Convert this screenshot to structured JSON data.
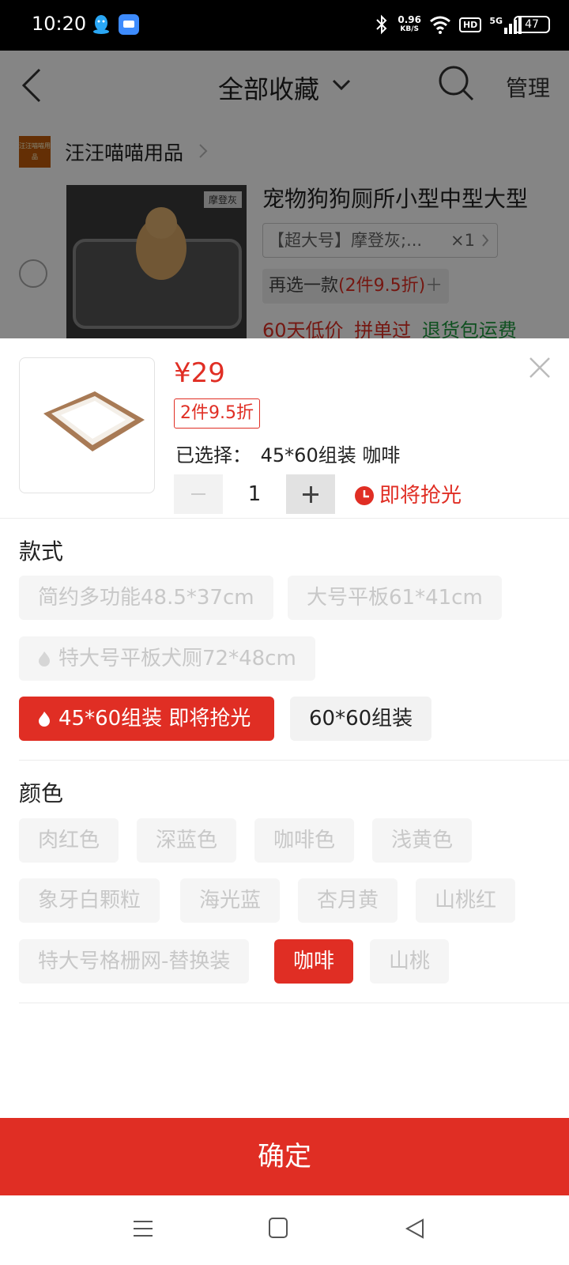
{
  "status_bar": {
    "time": "10:20",
    "net_speed_value": "0.96",
    "net_speed_unit": "KB/S",
    "hd": "HD",
    "signal": "5G",
    "battery": "47"
  },
  "background": {
    "title": "全部收藏",
    "manage": "管理",
    "shop_name": "汪汪喵喵用品",
    "shop_logo_text": "汪汪喵喵用品",
    "product_title": "宠物狗狗厕所小型中型大型",
    "product_tag": "摩登灰",
    "sku_text": "【超大号】摩登灰;...",
    "sku_qty": "×1",
    "reselect_prefix": "再选一款",
    "reselect_offer": "(2件9.5折)",
    "reselect_plus": "＋",
    "tag_low_price": "60天低价",
    "tag_group": "拼单过",
    "tag_return": "退货包运费"
  },
  "sheet": {
    "price": "¥29",
    "discount": "2件9.5折",
    "selected_label": "已选择：",
    "selected_value": "45*60组装 咖啡",
    "quantity": "1",
    "stock_hint": "即将抢光",
    "style_section": {
      "title": "款式",
      "options": [
        {
          "label": "简约多功能48.5*37cm",
          "state": "disabled"
        },
        {
          "label": "大号平板61*41cm",
          "state": "disabled"
        },
        {
          "label": "特大号平板犬厕72*48cm",
          "state": "disabled"
        },
        {
          "label": "45*60组装 即将抢光",
          "state": "selected"
        },
        {
          "label": "60*60组装",
          "state": "enabled"
        }
      ]
    },
    "color_section": {
      "title": "颜色",
      "options": [
        {
          "label": "肉红色",
          "state": "disabled"
        },
        {
          "label": "深蓝色",
          "state": "disabled"
        },
        {
          "label": "咖啡色",
          "state": "disabled"
        },
        {
          "label": "浅黄色",
          "state": "disabled"
        },
        {
          "label": "象牙白颗粒",
          "state": "disabled"
        },
        {
          "label": "海光蓝",
          "state": "disabled"
        },
        {
          "label": "杏月黄",
          "state": "disabled"
        },
        {
          "label": "山桃红",
          "state": "disabled"
        },
        {
          "label": "特大号格栅网-替换装",
          "state": "disabled"
        },
        {
          "label": "咖啡",
          "state": "selected"
        },
        {
          "label": "山桃",
          "state": "disabled"
        }
      ]
    },
    "confirm": "确定"
  },
  "colors": {
    "accent": "#e02e24",
    "disabled_text": "#c8c8c8",
    "option_bg": "#f5f5f5",
    "green_tag": "#1d9a3e"
  },
  "icons": [
    "back-arrow-icon",
    "chevron-down-icon",
    "search-icon",
    "close-icon",
    "clock-icon",
    "flame-icon",
    "menu-icon",
    "home-icon",
    "back-triangle-icon"
  ]
}
